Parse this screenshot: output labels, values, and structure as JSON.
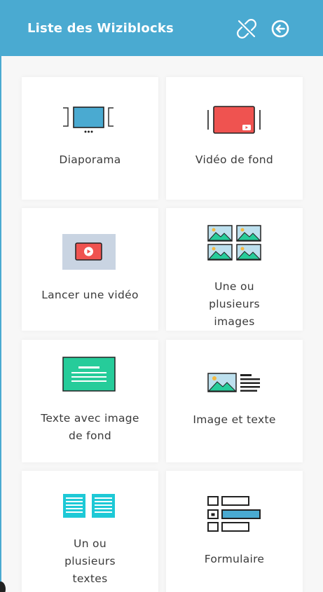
{
  "header": {
    "title": "Liste des Wiziblocks",
    "unlink_icon": "unlink-icon",
    "back_icon": "arrow-left-circle-icon",
    "background": "#4aaad1"
  },
  "blocks": [
    {
      "id": "diaporama",
      "label": "Diaporama",
      "icon": "slideshow-icon"
    },
    {
      "id": "video-fond",
      "label": "Vidéo de fond",
      "icon": "background-video-icon"
    },
    {
      "id": "lancer-video",
      "label": "Lancer une vidéo",
      "icon": "play-video-icon"
    },
    {
      "id": "images",
      "label": "Une ou plusieurs images",
      "icon": "images-grid-icon"
    },
    {
      "id": "texte-image-fond",
      "label": "Texte avec image de fond",
      "icon": "text-on-image-icon"
    },
    {
      "id": "image-texte",
      "label": "Image et texte",
      "icon": "image-and-text-icon"
    },
    {
      "id": "textes",
      "label": "Un ou plusieurs textes",
      "icon": "text-columns-icon"
    },
    {
      "id": "formulaire",
      "label": "Formulaire",
      "icon": "form-icon"
    }
  ],
  "colors": {
    "accent": "#4aaad1",
    "red": "#ef5350",
    "green": "#26cc9a",
    "teal": "#1ec9d6",
    "slate": "#c9d4e2"
  }
}
